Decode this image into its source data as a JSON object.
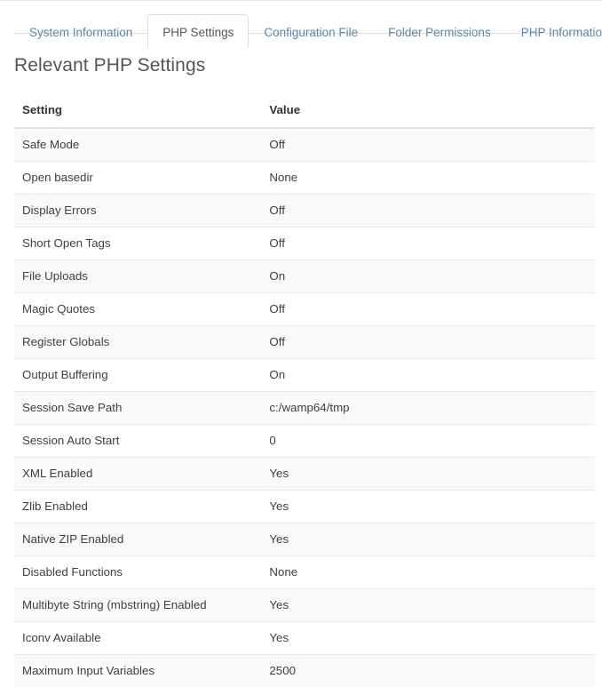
{
  "tabs": [
    {
      "label": "System Information",
      "active": false
    },
    {
      "label": "PHP Settings",
      "active": true
    },
    {
      "label": "Configuration File",
      "active": false
    },
    {
      "label": "Folder Permissions",
      "active": false
    },
    {
      "label": "PHP Information",
      "active": false
    }
  ],
  "page": {
    "title": "Relevant PHP Settings"
  },
  "table": {
    "columns": [
      "Setting",
      "Value"
    ],
    "rows": [
      {
        "setting": "Safe Mode",
        "value": "Off"
      },
      {
        "setting": "Open basedir",
        "value": "None"
      },
      {
        "setting": "Display Errors",
        "value": "Off"
      },
      {
        "setting": "Short Open Tags",
        "value": "Off"
      },
      {
        "setting": "File Uploads",
        "value": "On"
      },
      {
        "setting": "Magic Quotes",
        "value": "Off"
      },
      {
        "setting": "Register Globals",
        "value": "Off"
      },
      {
        "setting": "Output Buffering",
        "value": "On"
      },
      {
        "setting": "Session Save Path",
        "value": "c:/wamp64/tmp"
      },
      {
        "setting": "Session Auto Start",
        "value": "0"
      },
      {
        "setting": "XML Enabled",
        "value": "Yes"
      },
      {
        "setting": "Zlib Enabled",
        "value": "Yes"
      },
      {
        "setting": "Native ZIP Enabled",
        "value": "Yes"
      },
      {
        "setting": "Disabled Functions",
        "value": "None"
      },
      {
        "setting": "Multibyte String (mbstring) Enabled",
        "value": "Yes"
      },
      {
        "setting": "Iconv Available",
        "value": "Yes"
      },
      {
        "setting": "Maximum Input Variables",
        "value": "2500"
      }
    ]
  },
  "colors": {
    "link": "#5b86ad",
    "text": "#404040",
    "heading": "#555555",
    "border": "#dddddd",
    "stripe": "#f9f9f9"
  }
}
